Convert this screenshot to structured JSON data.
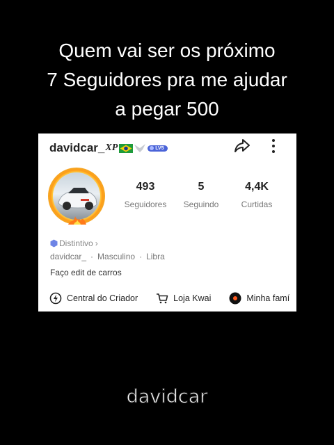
{
  "caption": {
    "line1": "Quem vai ser os próximo",
    "line2": "7 Seguidores pra me ajudar",
    "line3": "a pegar 500"
  },
  "profile": {
    "username": "davidcar_",
    "username_suffix": "XP",
    "level_badge": "LV5",
    "stats": [
      {
        "value": "493",
        "label": "Seguidores"
      },
      {
        "value": "5",
        "label": "Seguindo"
      },
      {
        "value": "4,4K",
        "label": "Curtidas"
      }
    ],
    "distintivo_label": "Distintivo",
    "meta": [
      "davidcar_",
      "Masculino",
      "Libra"
    ],
    "bio": "Faço edit de carros",
    "links": [
      {
        "label": "Central do Criador",
        "icon": "lightning-icon"
      },
      {
        "label": "Loja Kwai",
        "icon": "cart-icon"
      },
      {
        "label": "Minha famí",
        "icon": "record-icon"
      }
    ]
  },
  "watermark": "davidcar",
  "colors": {
    "badge": "#4a63d8",
    "avatar_ring": "#f5a623"
  }
}
